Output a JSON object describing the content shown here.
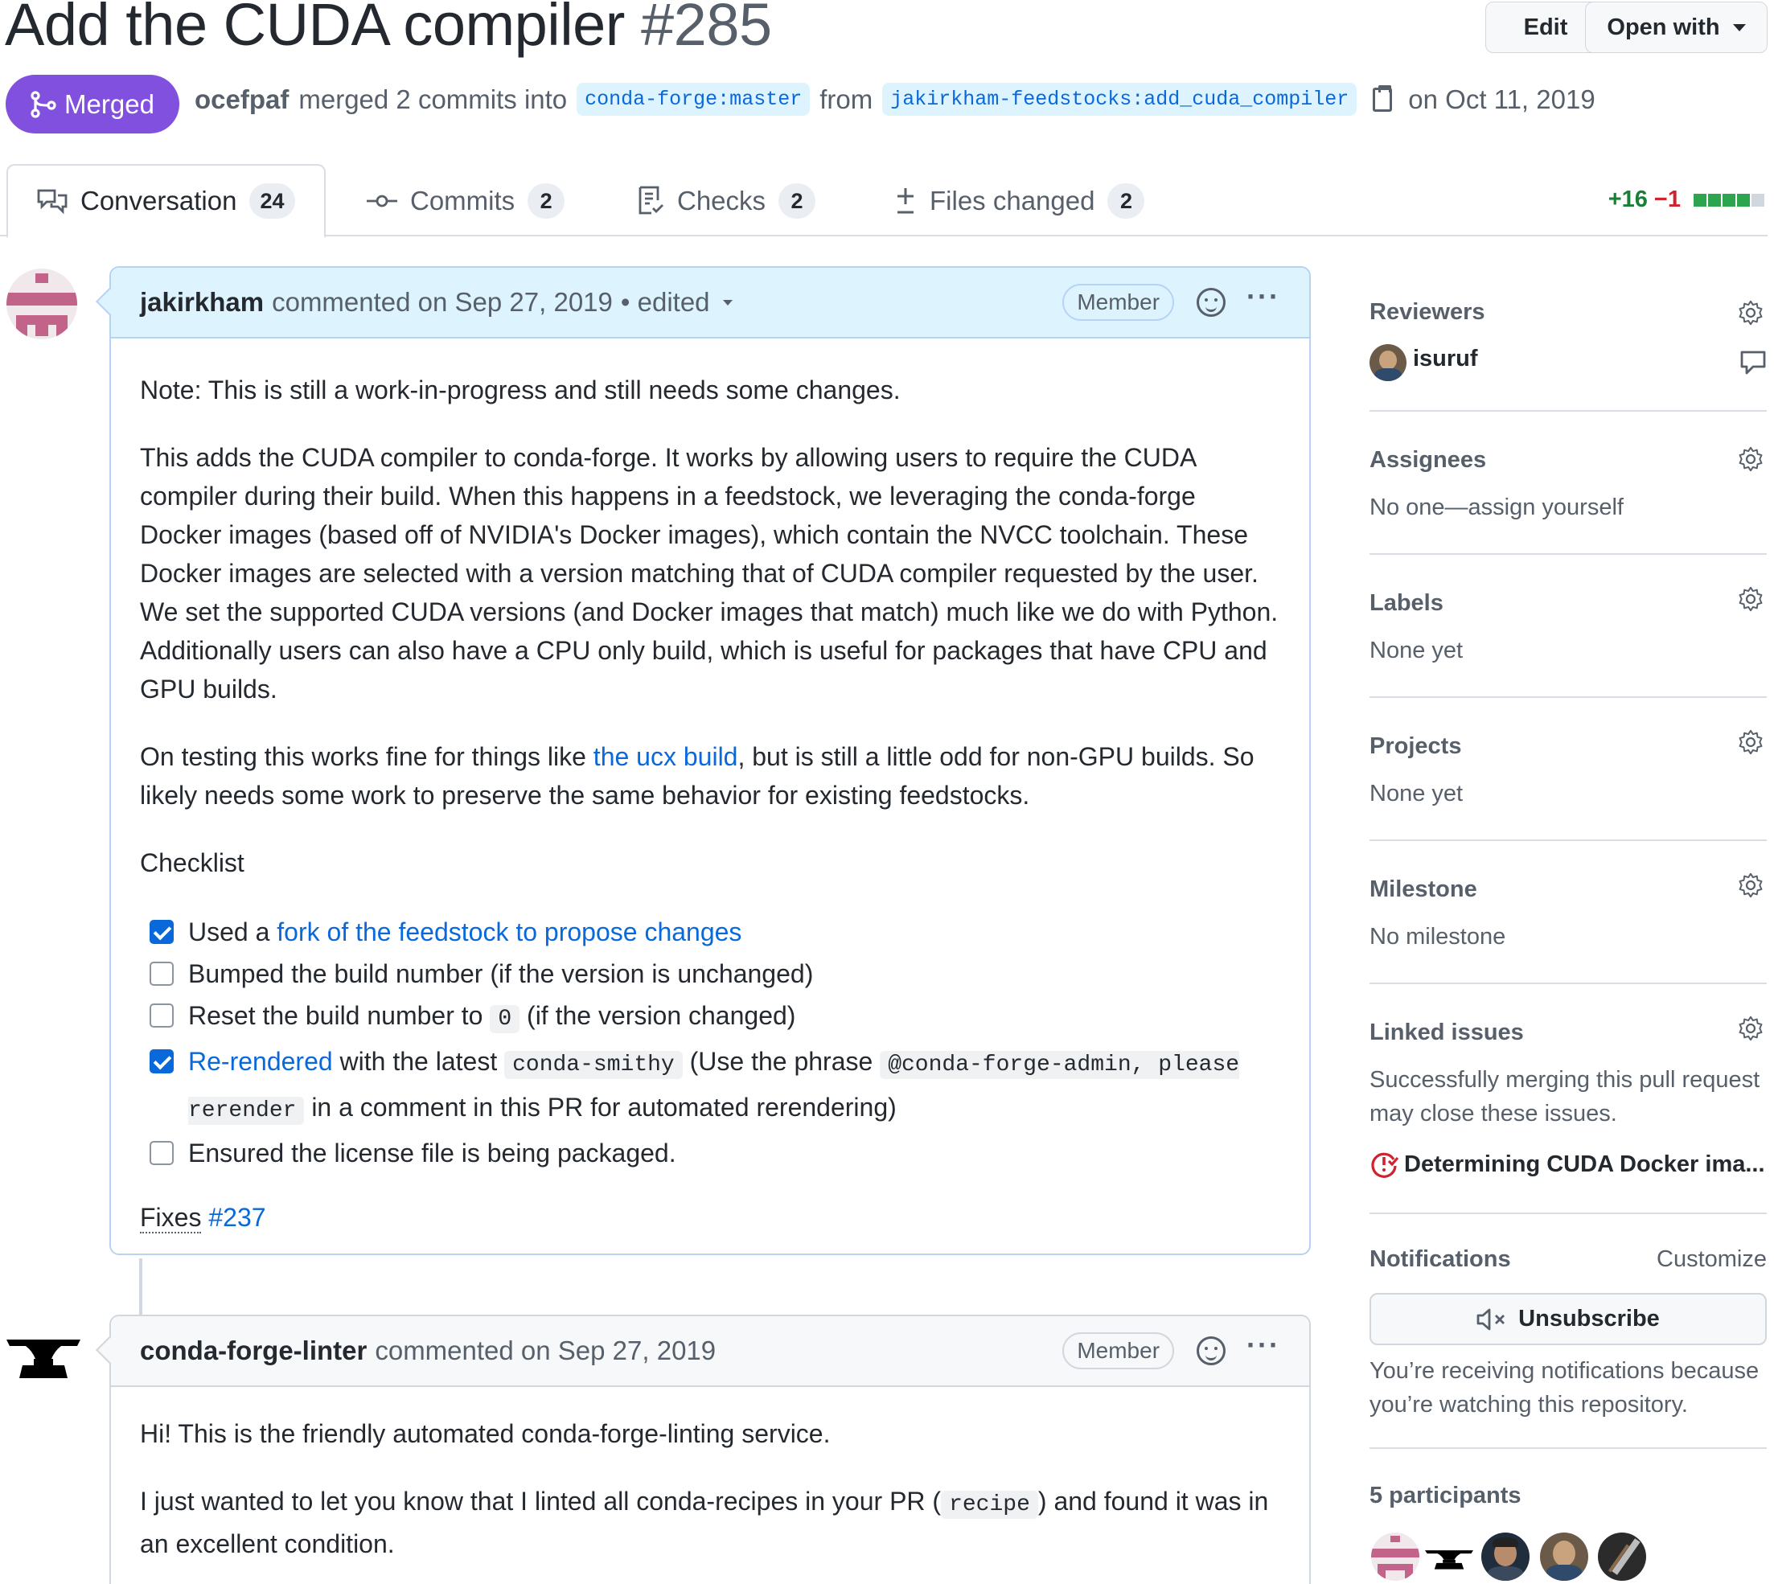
{
  "header": {
    "title": "Add the CUDA compiler",
    "number": "#285",
    "edit_label": "Edit",
    "open_with_label": "Open with",
    "state_label": "Merged",
    "merged_by": "ocefpaf",
    "merged_text": "merged 2 commits into",
    "base_branch": "conda-forge:master",
    "from_text": "from",
    "head_branch": "jakirkham-feedstocks:add_cuda_compiler",
    "date_text": "on Oct 11, 2019"
  },
  "tabs": [
    {
      "label": "Conversation",
      "count": "24",
      "icon": "comment-discussion-icon"
    },
    {
      "label": "Commits",
      "count": "2",
      "icon": "git-commit-icon"
    },
    {
      "label": "Checks",
      "count": "2",
      "icon": "checklist-icon"
    },
    {
      "label": "Files changed",
      "count": "2",
      "icon": "file-diff-icon"
    }
  ],
  "diffstat": {
    "additions": "+16",
    "deletions": "−1",
    "colors": {
      "add": "#2da44e",
      "neutral": "#d0d7de"
    }
  },
  "comment1": {
    "author": "jakirkham",
    "action": "commented on Sep 27, 2019",
    "edited": "• edited",
    "role": "Member",
    "p1": "Note: This is still a work-in-progress and still needs some changes.",
    "p2": "This adds the CUDA compiler to conda-forge. It works by allowing users to require the CUDA compiler during their build. When this happens in a feedstock, we leveraging the conda-forge Docker images (based off of NVIDIA's Docker images), which contain the NVCC toolchain. These Docker images are selected with a version matching that of CUDA compiler requested by the user. We set the supported CUDA versions (and Docker images that match) much like we do with Python. Additionally users can also have a CPU only build, which is useful for packages that have CPU and GPU builds.",
    "p3_before": "On testing this works fine for things like ",
    "p3_link": "the ucx build",
    "p3_after": ", but is still a little odd for non-GPU builds. So likely needs some work to preserve the same behavior for existing feedstocks.",
    "checklist_title": "Checklist",
    "checklist": {
      "item1_prefix": "Used a ",
      "item1_link": "fork of the feedstock to propose changes",
      "item2": "Bumped the build number (if the version is unchanged)",
      "item3_prefix": "Reset the build number to ",
      "item3_code": "0",
      "item3_suffix": " (if the version changed)",
      "item4_link": "Re-rendered",
      "item4_mid": " with the latest ",
      "item4_code1": "conda-smithy",
      "item4_mid2": " (Use the phrase ",
      "item4_code2": "@conda-forge-admin, please rerender",
      "item4_suffix": " in a comment in this PR for automated rerendering)",
      "item5": "Ensured the license file is being packaged.",
      "checked": [
        true,
        false,
        false,
        true,
        false
      ]
    },
    "fixes_label": "Fixes",
    "fixes_link": "#237"
  },
  "comment2": {
    "author": "conda-forge-linter",
    "action": "commented on Sep 27, 2019",
    "role": "Member",
    "p1": "Hi! This is the friendly automated conda-forge-linting service.",
    "p2_before": "I just wanted to let you know that I linted all conda-recipes in your PR (",
    "p2_code": "recipe",
    "p2_after": ") and found it was in an excellent condition."
  },
  "sidebar": {
    "reviewers_title": "Reviewers",
    "reviewer_name": "isuruf",
    "assignees_title": "Assignees",
    "assignees_text": "No one—assign yourself",
    "labels_title": "Labels",
    "labels_text": "None yet",
    "projects_title": "Projects",
    "projects_text": "None yet",
    "milestone_title": "Milestone",
    "milestone_text": "No milestone",
    "linked_title": "Linked issues",
    "linked_text": "Successfully merging this pull request may close these issues.",
    "linked_issue": "Determining CUDA Docker ima...",
    "notifications_title": "Notifications",
    "customize_label": "Customize",
    "unsubscribe_label": "Unsubscribe",
    "notifications_reason": "You’re receiving notifications because you’re watching this repository.",
    "participants_title": "5 participants"
  },
  "colors": {
    "merged": "#8250df",
    "link": "#0969da",
    "issue_closed": "#cf222e"
  }
}
